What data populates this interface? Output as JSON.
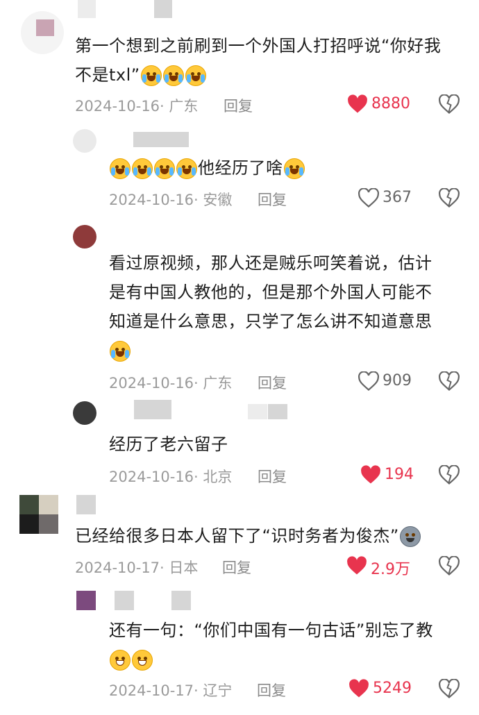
{
  "comments": [
    {
      "text_lines": [
        "第一个想到之前刷到一个外国人打招呼说“你好我",
        "不是txl”"
      ],
      "emoji_after": [
        "laugh-cry-emoji",
        "laugh-cry-emoji",
        "laugh-cry-emoji"
      ],
      "date": "2024-10-16",
      "location": "· 广东",
      "reply": "回复",
      "likes": "8880",
      "liked": true
    },
    {
      "text_lines": [
        "他经历了啥"
      ],
      "emoji_before": [
        "crying-emoji",
        "crying-emoji",
        "crying-emoji",
        "crying-emoji"
      ],
      "emoji_after": [
        "laugh-cry-emoji"
      ],
      "date": "2024-10-16",
      "location": "· 安徽",
      "reply": "回复",
      "likes": "367",
      "liked": false
    },
    {
      "text_lines": [
        "看过原视频，那人还是贼乐呵笑着说，估计",
        "是有中国人教他的，但是那个外国人可能不",
        "知道是什么意思，只学了怎么讲不知道意思"
      ],
      "emoji_line": [
        "laugh-cry-emoji"
      ],
      "date": "2024-10-16",
      "location": "· 广东",
      "reply": "回复",
      "likes": "909",
      "liked": false
    },
    {
      "text_lines": [
        "经历了老六留子"
      ],
      "date": "2024-10-16",
      "location": "· 北京",
      "reply": "回复",
      "likes": "194",
      "liked": true
    },
    {
      "text_lines": [
        "已经给很多日本人留下了“识时务者为俊杰”"
      ],
      "emoji_after": [
        "husky-emoji"
      ],
      "date": "2024-10-17",
      "location": "· 日本",
      "reply": "回复",
      "likes": "2.9万",
      "liked": true
    },
    {
      "text_lines": [
        "还有一句：“你们中国有一句古话”别忘了教"
      ],
      "emoji_line": [
        "grin-emoji",
        "grin-emoji"
      ],
      "date": "2024-10-17",
      "location": "· 辽宁",
      "reply": "回复",
      "likes": "5249",
      "liked": true
    }
  ],
  "colors": {
    "like_red": "#e8344e",
    "meta_grey": "#9a9a9a",
    "text": "#1d1d1d"
  }
}
